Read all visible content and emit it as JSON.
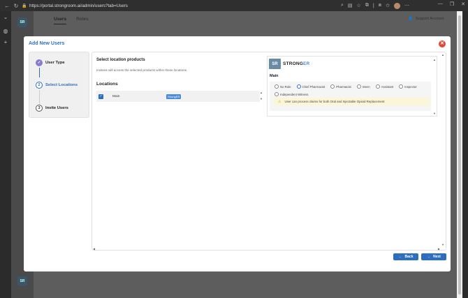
{
  "browser": {
    "url": "https://portal.strongroom.ai/admin/users?tab=Users"
  },
  "app": {
    "tabs": [
      "Users",
      "Roles"
    ],
    "support_label": "Support Account"
  },
  "modal": {
    "title": "Add New Users",
    "steps": [
      {
        "number": "1",
        "label": "User Type",
        "state": "done"
      },
      {
        "number": "2",
        "label": "Select Locations",
        "state": "current"
      },
      {
        "number": "3",
        "label": "Invite Users",
        "state": "pending"
      }
    ],
    "section_title": "Select location products",
    "section_subtitle": "Invitees will access the selected products within these locations.",
    "locations_title": "Locations",
    "location_row": {
      "name": "Main",
      "badge": "StrongER",
      "checked": true
    },
    "product": {
      "brand_prefix": "STRONG",
      "brand_suffix": "ER",
      "location": "Main",
      "roles": [
        {
          "label": "No Role",
          "selected": false
        },
        {
          "label": "Chief Pharmacist",
          "selected": true
        },
        {
          "label": "Pharmacist",
          "selected": false
        },
        {
          "label": "Intern",
          "selected": false
        },
        {
          "label": "Assistant",
          "selected": false
        },
        {
          "label": "Inspector",
          "selected": false
        },
        {
          "label": "Independent Witness",
          "selected": false
        }
      ],
      "warning": "User can process claims for both Oral and Injectable Opioid Replacement"
    },
    "buttons": {
      "back": "Back",
      "next": "Next"
    }
  },
  "colors": {
    "accent": "#2d6ec0",
    "danger": "#e04a3d",
    "warning_bg": "#fbf6d8"
  }
}
